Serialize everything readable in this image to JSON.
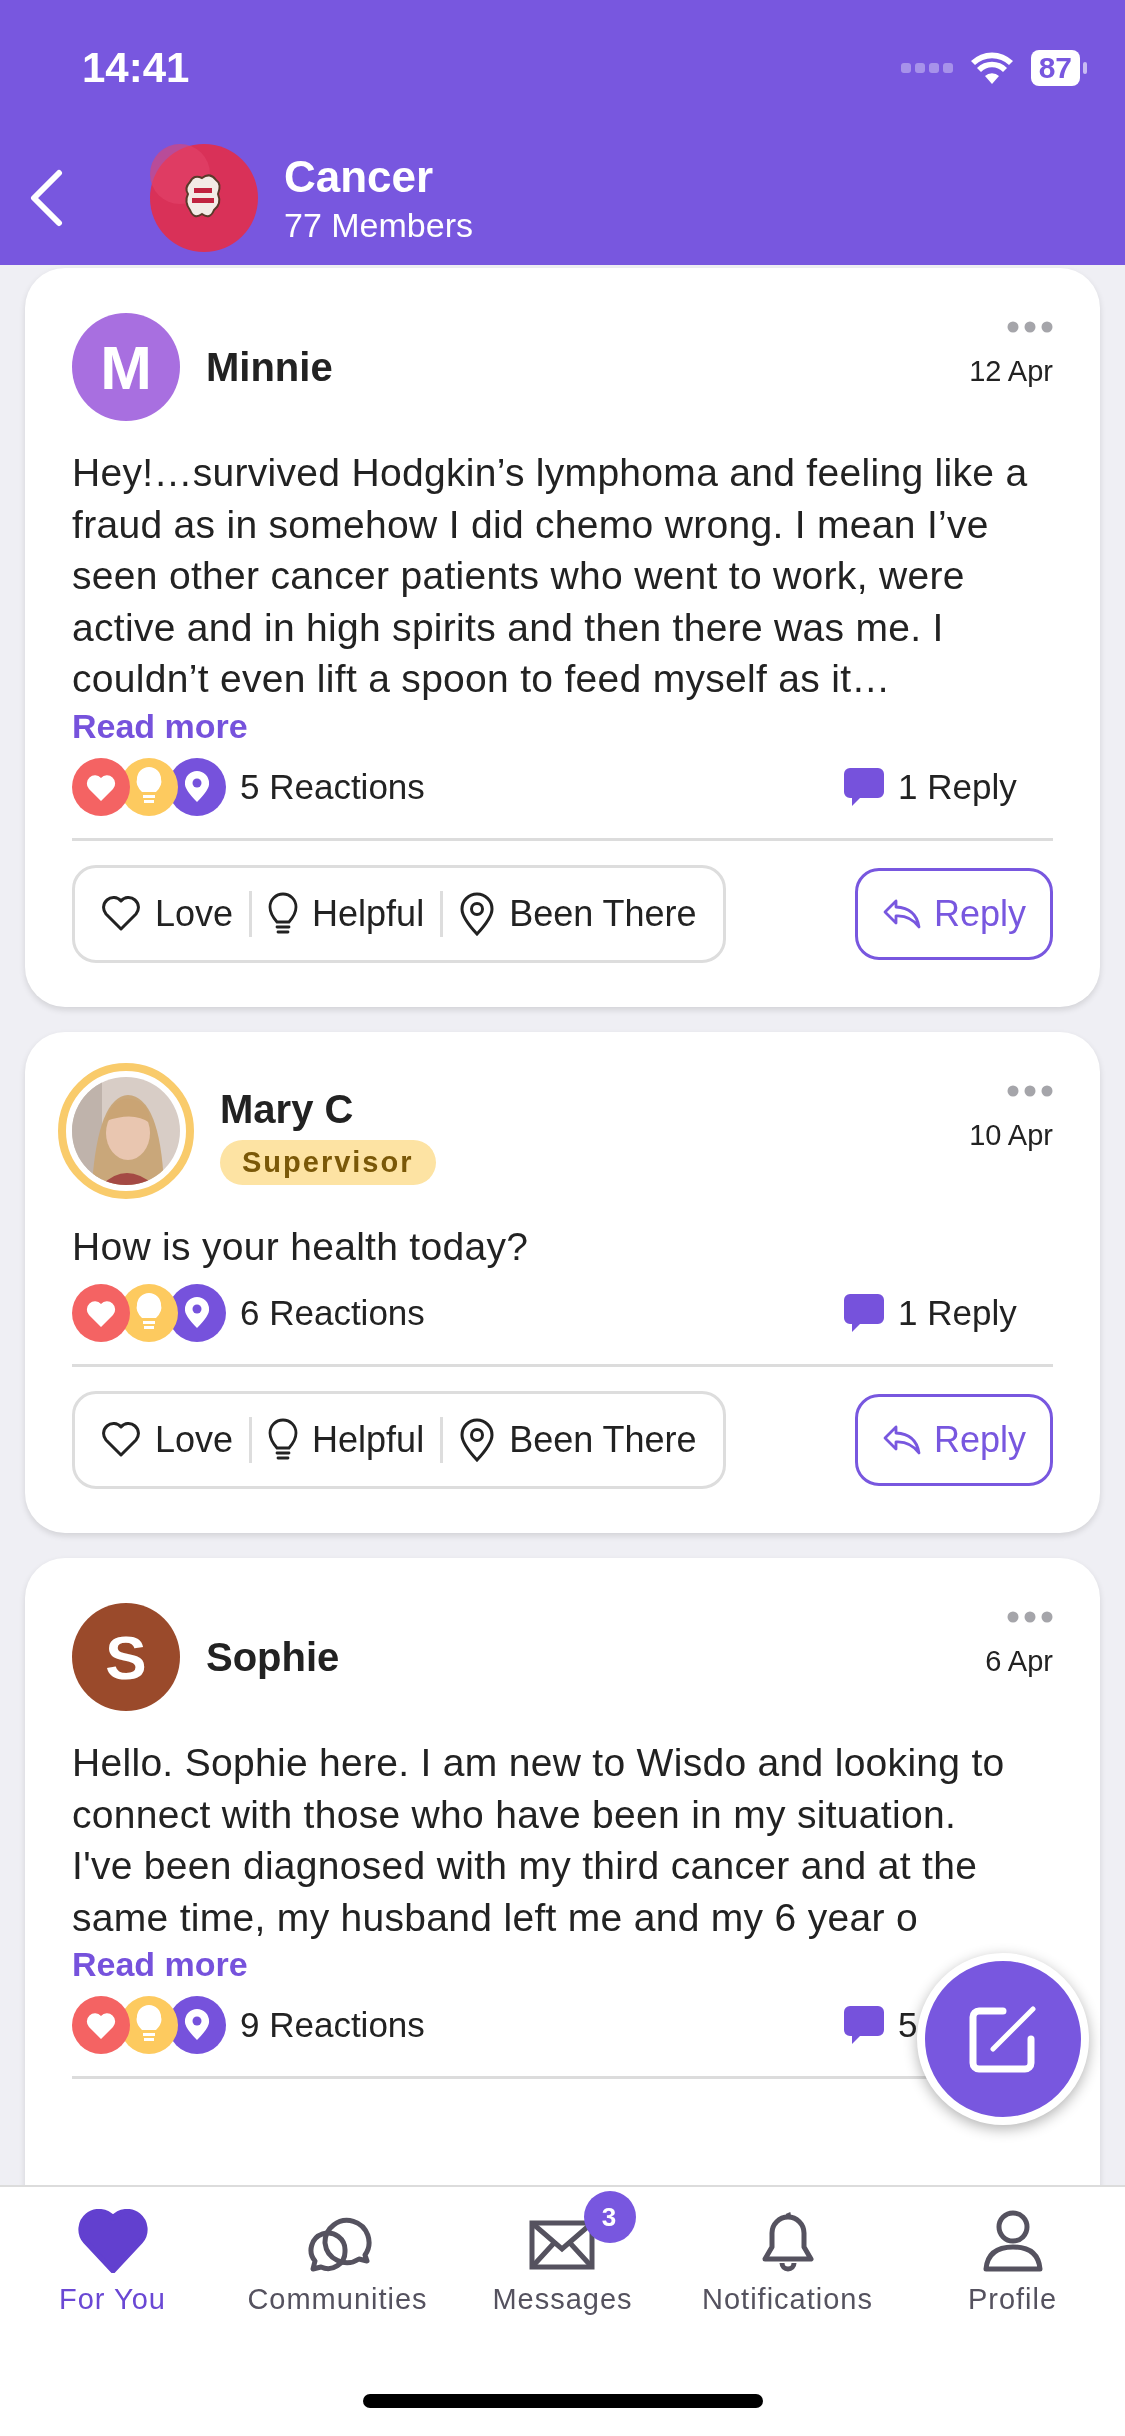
{
  "status_bar": {
    "time": "14:41",
    "battery": "87"
  },
  "header": {
    "title": "Cancer",
    "subtitle": "77 Members"
  },
  "posts": [
    {
      "author": "Minnie",
      "avatar": {
        "kind": "letter",
        "letter": "M",
        "color": "#a86fe0"
      },
      "date": "12 Apr",
      "body": "Hey!…survived Hodgkin’s lymphoma and feeling like a fraud as in somehow I did chemo wrong. I mean I’ve seen other cancer patients who went to work, were active and in high spirits and then there was me. I couldn’t even lift a spoon to feed myself as it…",
      "read_more": "Read more",
      "reactions": "5 Reactions",
      "replies": "1 Reply",
      "actions": [
        {
          "kind": "love",
          "label": "Love"
        },
        {
          "kind": "helpful",
          "label": "Helpful"
        },
        {
          "kind": "been_there",
          "label": "Been There"
        }
      ],
      "reply_button": "Reply"
    },
    {
      "author": "Mary C",
      "badge": "Supervisor",
      "date": "10 Apr",
      "body": "How is your health today?",
      "reactions": "6 Reactions",
      "replies": "1 Reply",
      "actions": [
        {
          "kind": "love",
          "label": "Love"
        },
        {
          "kind": "helpful",
          "label": "Helpful"
        },
        {
          "kind": "been_there",
          "label": "Been There"
        }
      ],
      "reply_button": "Reply"
    },
    {
      "author": "Sophie",
      "avatar": {
        "kind": "letter",
        "letter": "S",
        "color": "#9a4a2b"
      },
      "date": "6 Apr",
      "body": "Hello. Sophie here. I am new to Wisdo and looking to connect with those who have been in my situation.\nI've been diagnosed with my third cancer and at the same time, my husband left me and my 6 year o",
      "read_more": "Read more",
      "reactions": "9 Reactions",
      "replies": "5"
    }
  ],
  "tabs": [
    {
      "kind": "heart",
      "label": "For You",
      "selected": true
    },
    {
      "kind": "chat",
      "label": "Communities",
      "selected": false
    },
    {
      "kind": "mail",
      "label": "Messages",
      "selected": false,
      "badge": "3"
    },
    {
      "kind": "bell",
      "label": "Notifications",
      "selected": false
    },
    {
      "kind": "person",
      "label": "Profile",
      "selected": false
    }
  ]
}
